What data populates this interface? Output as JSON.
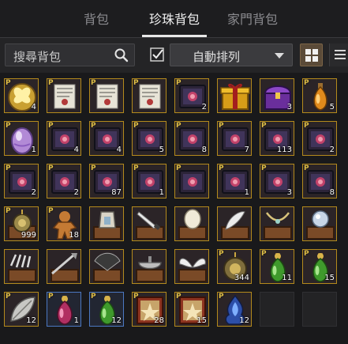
{
  "tabs": [
    {
      "label": "背包",
      "active": false
    },
    {
      "label": "珍珠背包",
      "active": true
    },
    {
      "label": "家門背包",
      "active": false
    }
  ],
  "toolbar": {
    "search_placeholder": "搜尋背包",
    "checkbox_checked": true,
    "sort_label": "自動排列"
  },
  "slot_marker": "P",
  "slots": [
    {
      "icon": "butterfly-orb-icon",
      "frame": "gold",
      "p": true,
      "qty": "4"
    },
    {
      "icon": "scroll-paper-icon",
      "frame": "gold",
      "p": true,
      "qty": ""
    },
    {
      "icon": "scroll-paper-icon",
      "frame": "gold",
      "p": true,
      "qty": ""
    },
    {
      "icon": "scroll-paper-icon",
      "frame": "gold",
      "p": true,
      "qty": ""
    },
    {
      "icon": "dark-banner-icon",
      "frame": "gold",
      "p": true,
      "qty": "2"
    },
    {
      "icon": "gold-gift-box-icon",
      "frame": "gold",
      "p": false,
      "qty": ""
    },
    {
      "icon": "purple-treasure-chest-icon",
      "frame": "gold",
      "p": false,
      "qty": "3"
    },
    {
      "icon": "amber-potion-icon",
      "frame": "gold",
      "p": true,
      "qty": "5"
    },
    {
      "icon": "purple-egg-icon",
      "frame": "gold",
      "p": true,
      "qty": "1"
    },
    {
      "icon": "dark-banner-icon",
      "frame": "gold",
      "p": true,
      "qty": "4"
    },
    {
      "icon": "dark-banner-icon",
      "frame": "gold",
      "p": true,
      "qty": "4"
    },
    {
      "icon": "dark-banner-icon",
      "frame": "gold",
      "p": true,
      "qty": "5"
    },
    {
      "icon": "dark-banner-icon",
      "frame": "gold",
      "p": true,
      "qty": "8"
    },
    {
      "icon": "dark-banner-icon",
      "frame": "gold",
      "p": true,
      "qty": "7"
    },
    {
      "icon": "dark-banner-icon",
      "frame": "gold",
      "p": true,
      "qty": "113"
    },
    {
      "icon": "dark-banner-icon",
      "frame": "gold",
      "p": true,
      "qty": "2"
    },
    {
      "icon": "dark-banner-icon",
      "frame": "gold",
      "p": true,
      "qty": "2"
    },
    {
      "icon": "dark-banner-icon",
      "frame": "gold",
      "p": true,
      "qty": "2"
    },
    {
      "icon": "dark-banner-icon",
      "frame": "gold",
      "p": true,
      "qty": "87"
    },
    {
      "icon": "dark-banner-icon",
      "frame": "gold",
      "p": true,
      "qty": "1"
    },
    {
      "icon": "dark-banner-icon",
      "frame": "gold",
      "p": true,
      "qty": ""
    },
    {
      "icon": "dark-banner-icon",
      "frame": "gold",
      "p": true,
      "qty": "1"
    },
    {
      "icon": "dark-banner-icon",
      "frame": "gold",
      "p": true,
      "qty": "3"
    },
    {
      "icon": "dark-banner-icon",
      "frame": "gold",
      "p": true,
      "qty": "8"
    },
    {
      "icon": "amulet-chest-icon",
      "frame": "gold",
      "p": true,
      "qty": "999"
    },
    {
      "icon": "gingerbread-icon",
      "frame": "gold",
      "p": true,
      "qty": "18"
    },
    {
      "icon": "lantern-chest-icon",
      "frame": "gold",
      "p": false,
      "qty": ""
    },
    {
      "icon": "dagger-chest-icon",
      "frame": "gold",
      "p": false,
      "qty": ""
    },
    {
      "icon": "egg-chest-icon",
      "frame": "gold",
      "p": false,
      "qty": ""
    },
    {
      "icon": "feather-chest-icon",
      "frame": "gold",
      "p": false,
      "qty": ""
    },
    {
      "icon": "necklace-chest-icon",
      "frame": "gold",
      "p": false,
      "qty": ""
    },
    {
      "icon": "orb-chest-icon",
      "frame": "gold",
      "p": false,
      "qty": ""
    },
    {
      "icon": "claw-chest-icon",
      "frame": "gold",
      "p": false,
      "qty": ""
    },
    {
      "icon": "spear-chest-icon",
      "frame": "gold",
      "p": false,
      "qty": ""
    },
    {
      "icon": "fan-chest-icon",
      "frame": "gold",
      "p": false,
      "qty": ""
    },
    {
      "icon": "bowl-chest-icon",
      "frame": "gold",
      "p": false,
      "qty": ""
    },
    {
      "icon": "wings-chest-icon",
      "frame": "gold",
      "p": false,
      "qty": ""
    },
    {
      "icon": "amulet-icon",
      "frame": "gold",
      "p": true,
      "qty": "344"
    },
    {
      "icon": "green-potion-icon",
      "frame": "gold",
      "p": true,
      "qty": "11"
    },
    {
      "icon": "green-potion-icon",
      "frame": "gold",
      "p": true,
      "qty": "15"
    },
    {
      "icon": "silver-leaf-icon",
      "frame": "gold",
      "p": true,
      "qty": "12"
    },
    {
      "icon": "pink-potion-icon",
      "frame": "blue",
      "p": true,
      "qty": "1"
    },
    {
      "icon": "green-potion-icon",
      "frame": "blue",
      "p": true,
      "qty": "12"
    },
    {
      "icon": "red-book-icon",
      "frame": "gold",
      "p": true,
      "qty": "28"
    },
    {
      "icon": "red-book-icon",
      "frame": "gold",
      "p": true,
      "qty": "15"
    },
    {
      "icon": "blue-flame-stone-icon",
      "frame": "gold",
      "p": true,
      "qty": "12"
    },
    {
      "icon": "empty-slot",
      "frame": "empty",
      "p": false,
      "qty": ""
    },
    {
      "icon": "empty-slot",
      "frame": "empty",
      "p": false,
      "qty": ""
    }
  ]
}
